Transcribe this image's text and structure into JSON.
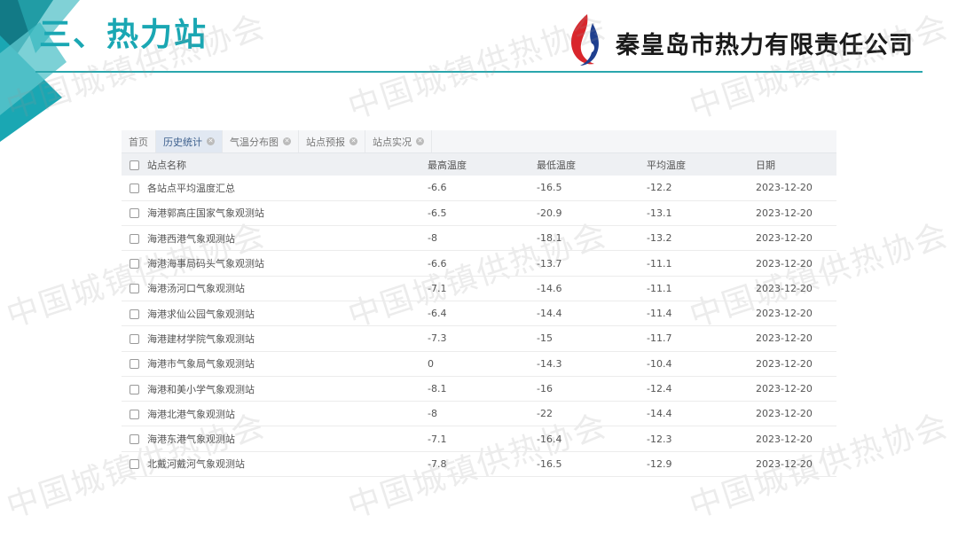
{
  "slide": {
    "title": "三、热力站",
    "company": "秦皇岛市热力有限责任公司",
    "watermark": "中国城镇供热协会",
    "accent_color": "#1aa7b3"
  },
  "tabs": [
    {
      "label": "首页",
      "closable": false,
      "active": false
    },
    {
      "label": "历史统计",
      "closable": true,
      "active": true
    },
    {
      "label": "气温分布图",
      "closable": true,
      "active": false
    },
    {
      "label": "站点预报",
      "closable": true,
      "active": false
    },
    {
      "label": "站点实况",
      "closable": true,
      "active": false
    }
  ],
  "table": {
    "headers": {
      "name": "站点名称",
      "max": "最高温度",
      "min": "最低温度",
      "avg": "平均温度",
      "date": "日期"
    },
    "rows": [
      {
        "name": "各站点平均温度汇总",
        "max": "-6.6",
        "min": "-16.5",
        "avg": "-12.2",
        "date": "2023-12-20"
      },
      {
        "name": "海港郭高庄国家气象观测站",
        "max": "-6.5",
        "min": "-20.9",
        "avg": "-13.1",
        "date": "2023-12-20"
      },
      {
        "name": "海港西港气象观测站",
        "max": "-8",
        "min": "-18.1",
        "avg": "-13.2",
        "date": "2023-12-20"
      },
      {
        "name": "海港海事局码头气象观测站",
        "max": "-6.6",
        "min": "-13.7",
        "avg": "-11.1",
        "date": "2023-12-20"
      },
      {
        "name": "海港汤河口气象观测站",
        "max": "-7.1",
        "min": "-14.6",
        "avg": "-11.1",
        "date": "2023-12-20"
      },
      {
        "name": "海港求仙公园气象观测站",
        "max": "-6.4",
        "min": "-14.4",
        "avg": "-11.4",
        "date": "2023-12-20"
      },
      {
        "name": "海港建材学院气象观测站",
        "max": "-7.3",
        "min": "-15",
        "avg": "-11.7",
        "date": "2023-12-20"
      },
      {
        "name": "海港市气象局气象观测站",
        "max": "0",
        "min": "-14.3",
        "avg": "-10.4",
        "date": "2023-12-20"
      },
      {
        "name": "海港和美小学气象观测站",
        "max": "-8.1",
        "min": "-16",
        "avg": "-12.4",
        "date": "2023-12-20"
      },
      {
        "name": "海港北港气象观测站",
        "max": "-8",
        "min": "-22",
        "avg": "-14.4",
        "date": "2023-12-20"
      },
      {
        "name": "海港东港气象观测站",
        "max": "-7.1",
        "min": "-16.4",
        "avg": "-12.3",
        "date": "2023-12-20"
      },
      {
        "name": "北戴河戴河气象观测站",
        "max": "-7.8",
        "min": "-16.5",
        "avg": "-12.9",
        "date": "2023-12-20"
      }
    ]
  }
}
